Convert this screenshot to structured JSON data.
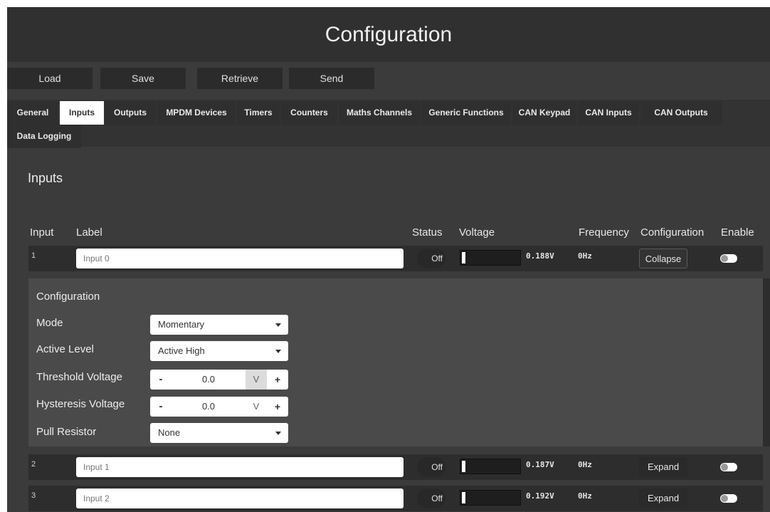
{
  "header": {
    "title": "Configuration"
  },
  "toolbar": {
    "buttons": [
      "Load",
      "Save",
      "Retrieve",
      "Send"
    ]
  },
  "tabs": [
    "General",
    "Inputs",
    "Outputs",
    "MPDM Devices",
    "Timers",
    "Counters",
    "Maths Channels",
    "Generic Functions",
    "CAN Keypad",
    "CAN Inputs",
    "CAN Outputs",
    "Data Logging"
  ],
  "active_tab": "Inputs",
  "section": {
    "title": "Inputs"
  },
  "columns": {
    "input": "Input",
    "label": "Label",
    "status": "Status",
    "voltage": "Voltage",
    "frequency": "Frequency",
    "configuration": "Configuration",
    "enable": "Enable"
  },
  "rows": [
    {
      "num": "1",
      "label": "Input 0",
      "status": "Off",
      "voltage": "0.188V",
      "frequency": "0Hz",
      "config_btn": "Collapse",
      "voltage_level": 0.06,
      "enabled": false
    },
    {
      "num": "2",
      "label": "Input 1",
      "status": "Off",
      "voltage": "0.187V",
      "frequency": "0Hz",
      "config_btn": "Expand",
      "voltage_level": 0.06,
      "enabled": false
    },
    {
      "num": "3",
      "label": "Input 2",
      "status": "Off",
      "voltage": "0.192V",
      "frequency": "0Hz",
      "config_btn": "Expand",
      "voltage_level": 0.06,
      "enabled": false
    }
  ],
  "config_panel": {
    "title": "Configuration",
    "mode_label": "Mode",
    "mode_value": "Momentary",
    "active_level_label": "Active Level",
    "active_level_value": "Active High",
    "threshold_label": "Threshold Voltage",
    "threshold_value": "0.0",
    "threshold_unit": "V",
    "hysteresis_label": "Hysteresis Voltage",
    "hysteresis_value": "0.0",
    "hysteresis_unit": "V",
    "pull_label": "Pull Resistor",
    "pull_value": "None",
    "minus": "-",
    "plus": "+"
  },
  "colors": {
    "background": "#3b3b3b",
    "header": "#303030",
    "panel": "#4a4a4a",
    "row": "#2d2d2d",
    "active_tab": "#ffffff"
  }
}
